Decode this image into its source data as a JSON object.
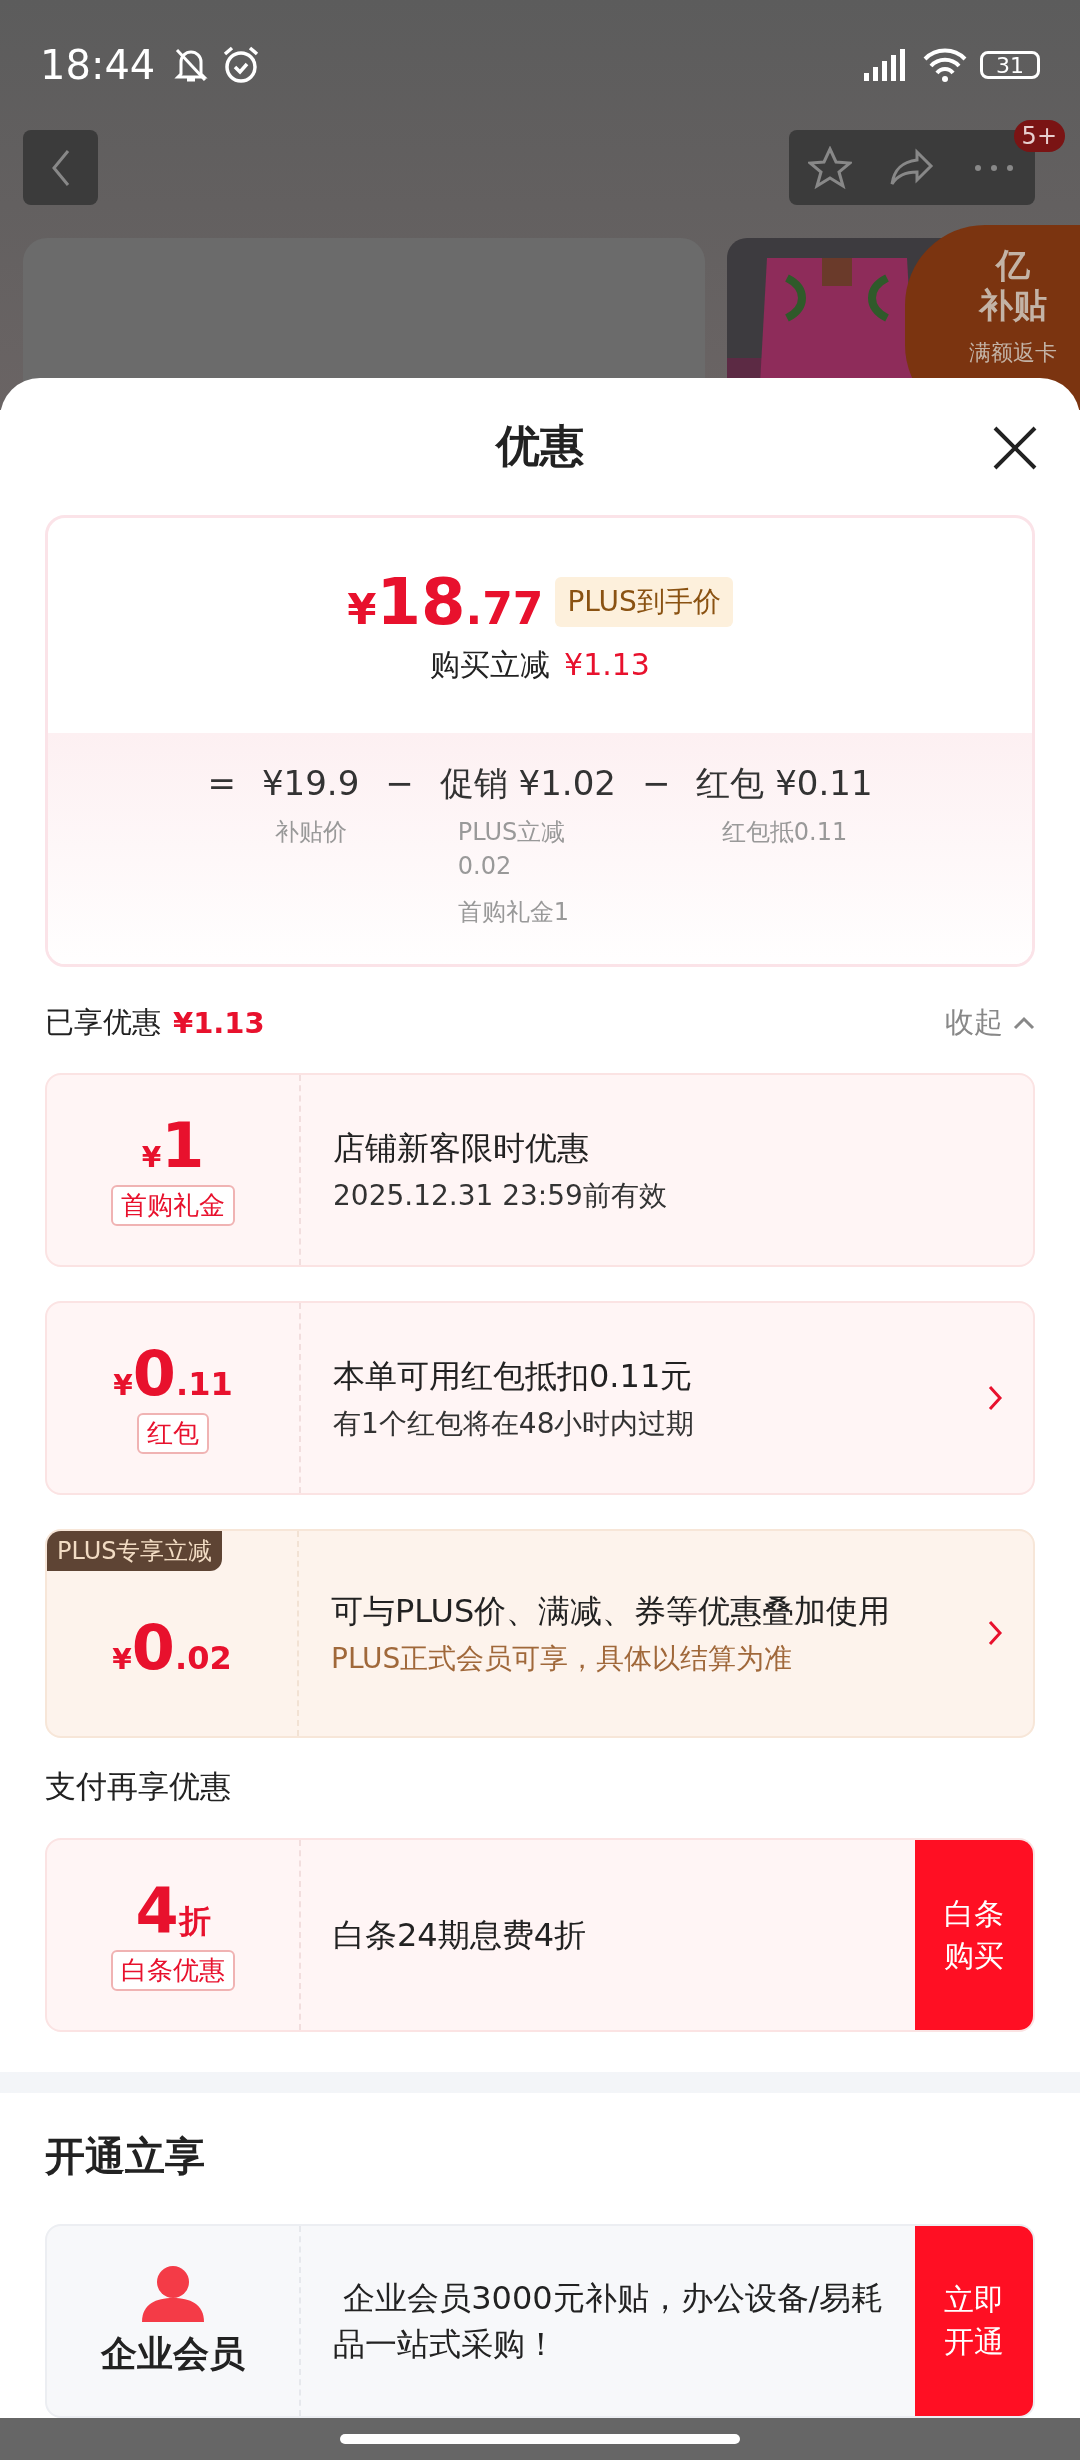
{
  "status_bar": {
    "time": "18:44",
    "battery": "31"
  },
  "top_nav": {
    "badge": "5+"
  },
  "banner": {
    "lines": [
      "亿",
      "补贴",
      "满额返卡"
    ]
  },
  "sheet": {
    "title": "优惠"
  },
  "price_summary": {
    "currency": "¥",
    "integer": "18",
    "decimal": ".77",
    "tag": "PLUS到手价",
    "saving_label": "购买立减",
    "saving": "¥1.13",
    "breakdown": [
      {
        "sign": "=",
        "amount": "¥19.9",
        "notes": [
          "补贴价"
        ]
      },
      {
        "sign": "−",
        "label": "促销",
        "amount": "¥1.02",
        "notes": [
          "PLUS立减0.02",
          "首购礼金1"
        ]
      },
      {
        "sign": "−",
        "label": "红包",
        "amount": "¥0.11",
        "notes": [
          "红包抵0.11"
        ]
      }
    ]
  },
  "enjoyed": {
    "label": "已享优惠",
    "amount": "¥1.13",
    "toggle": "收起",
    "expanded": true
  },
  "coupons": [
    {
      "kind": "coupon",
      "currency": "¥",
      "integer": "1",
      "tag": "首购礼金",
      "title": "店铺新客限时优惠",
      "subtitle": "2025.12.31 23:59前有效",
      "arrow": false
    },
    {
      "kind": "coupon",
      "currency": "¥",
      "integer": "0",
      "decimal": ".11",
      "tag": "红包",
      "title": "本单可用红包抵扣0.11元",
      "subtitle": "有1个红包将在48小时内过期",
      "arrow": true
    },
    {
      "kind": "plus",
      "corner": "PLUS专享立减",
      "currency": "¥",
      "integer": "0",
      "decimal": ".02",
      "title": "可与PLUS价、满减、券等优惠叠加使用",
      "subtitle": "PLUS正式会员可享，具体以结算为准",
      "arrow": true
    }
  ],
  "payment": {
    "heading": "支付再享优惠",
    "offers": [
      {
        "kind": "discount",
        "integer": "4",
        "unit": "折",
        "tag": "白条优惠",
        "title": "白条24期息费4折",
        "action": "白条购买"
      }
    ]
  },
  "open": {
    "heading": "开通立享",
    "offers": [
      {
        "kind": "membership",
        "label": "企业会员",
        "title": " 企业会员3000元补贴，办公设备/易耗品一站式采购！",
        "action": "立即开通"
      }
    ]
  }
}
